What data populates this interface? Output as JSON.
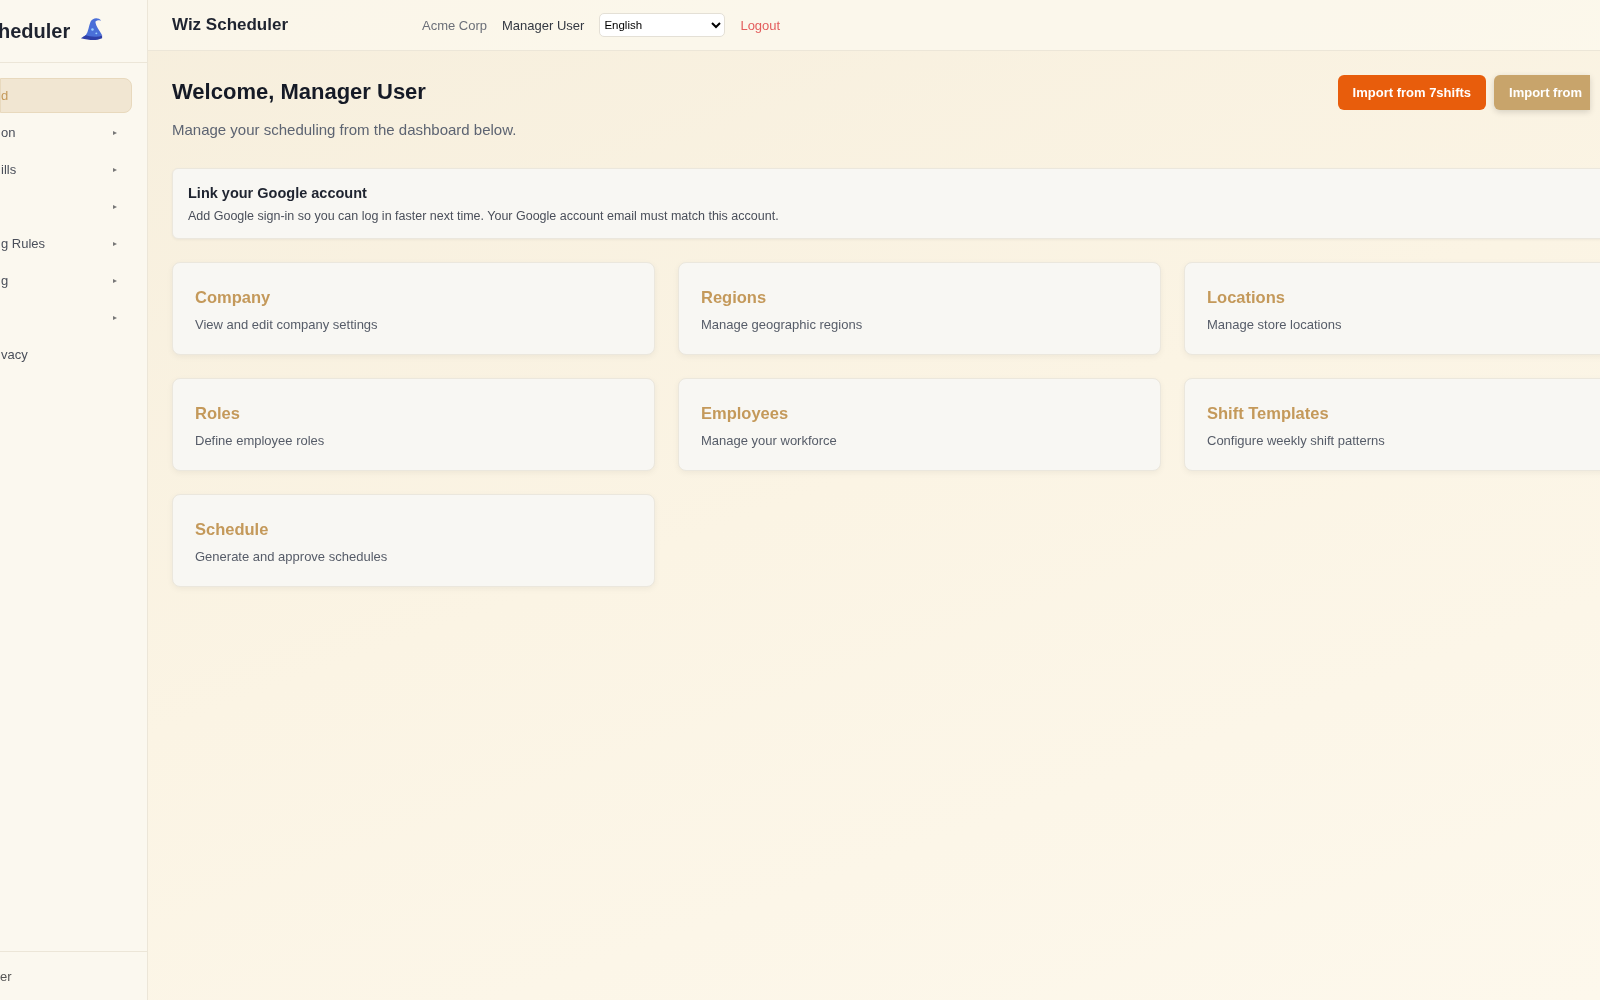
{
  "sidebar": {
    "brand": "heduler",
    "items": [
      {
        "label": "d",
        "selected": true,
        "expandable": false
      },
      {
        "label": "on",
        "selected": false,
        "expandable": true
      },
      {
        "label": "ills",
        "selected": false,
        "expandable": true
      },
      {
        "selected": false,
        "expandable": true
      },
      {
        "label": "g Rules",
        "selected": false,
        "expandable": true
      },
      {
        "label": "g",
        "selected": false,
        "expandable": true
      },
      {
        "selected": false,
        "expandable": true
      },
      {
        "label": "vacy",
        "selected": false,
        "expandable": false
      }
    ],
    "footer": "er"
  },
  "header": {
    "app_title": "Wiz Scheduler",
    "company": "Acme Corp",
    "user": "Manager User",
    "language": "English",
    "logout": "Logout"
  },
  "page": {
    "title": "Welcome, Manager User",
    "subtitle": "Manage your scheduling from the dashboard below.",
    "actions": [
      {
        "label": "Import from 7shifts",
        "kind": "primary"
      },
      {
        "label": "Import from",
        "kind": "secondary"
      }
    ]
  },
  "banner": {
    "title": "Link your Google account",
    "text": "Add Google sign-in so you can log in faster next time. Your Google account email must match this account."
  },
  "cards": [
    {
      "title": "Company",
      "description": "View and edit company settings"
    },
    {
      "title": "Regions",
      "description": "Manage geographic regions"
    },
    {
      "title": "Locations",
      "description": "Manage store locations"
    },
    {
      "title": "Roles",
      "description": "Define employee roles"
    },
    {
      "title": "Employees",
      "description": "Manage your workforce"
    },
    {
      "title": "Shift Templates",
      "description": "Configure weekly shift patterns"
    },
    {
      "title": "Schedule",
      "description": "Generate and approve schedules"
    }
  ]
}
